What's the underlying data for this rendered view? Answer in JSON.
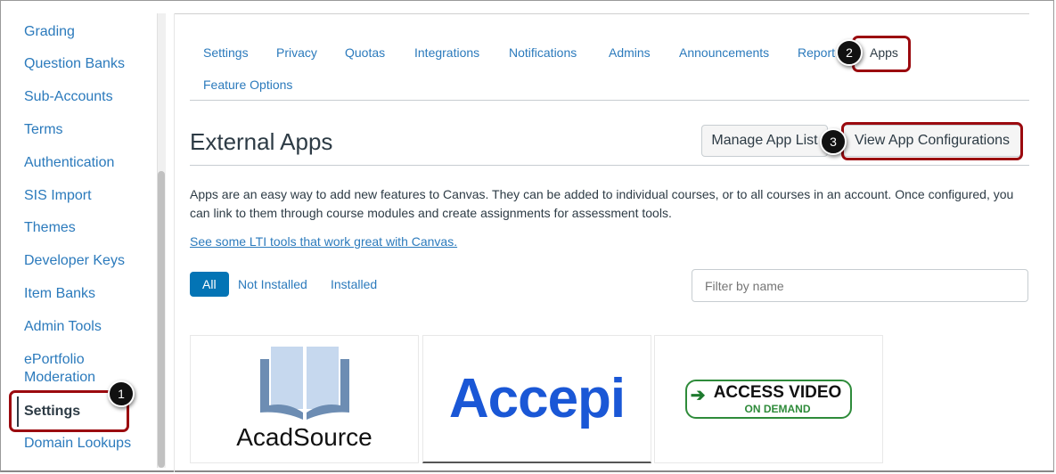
{
  "sidebar": {
    "items": [
      {
        "label": "Grading"
      },
      {
        "label": "Question Banks"
      },
      {
        "label": "Sub-Accounts"
      },
      {
        "label": "Terms"
      },
      {
        "label": "Authentication"
      },
      {
        "label": "SIS Import"
      },
      {
        "label": "Themes"
      },
      {
        "label": "Developer Keys"
      },
      {
        "label": "Item Banks"
      },
      {
        "label": "Admin Tools"
      },
      {
        "label": "ePortfolio"
      },
      {
        "label": "Moderation"
      },
      {
        "label": "Settings"
      },
      {
        "label": "Domain Lookups"
      }
    ]
  },
  "tabs": [
    {
      "label": "Settings"
    },
    {
      "label": "Privacy"
    },
    {
      "label": "Quotas"
    },
    {
      "label": "Integrations"
    },
    {
      "label": "Notifications"
    },
    {
      "label": "Admins"
    },
    {
      "label": "Announcements"
    },
    {
      "label": "Report"
    },
    {
      "label": "Apps"
    },
    {
      "label": "Feature Options"
    }
  ],
  "page": {
    "title": "External Apps",
    "manage_label": "Manage App List",
    "view_config_label": "View App Configurations",
    "description": "Apps are an easy way to add new features to Canvas. They can be added to individual courses, or to all courses in an account. Once configured, you can link to them through course modules and create assignments for assessment tools.",
    "lti_link": "See some LTI tools that work great with Canvas."
  },
  "filters": {
    "all": "All",
    "not_installed": "Not Installed",
    "installed": "Installed",
    "search_placeholder": "Filter by name"
  },
  "apps": [
    {
      "name": "AcadSource"
    },
    {
      "name": "Accepi"
    },
    {
      "name": "ACCESS VIDEO",
      "sub": "ON DEMAND"
    }
  ],
  "callouts": [
    "1",
    "2",
    "3"
  ],
  "colors": {
    "link": "#2b7abc",
    "highlight": "#9b0a0f",
    "primary": "#0374b5"
  }
}
